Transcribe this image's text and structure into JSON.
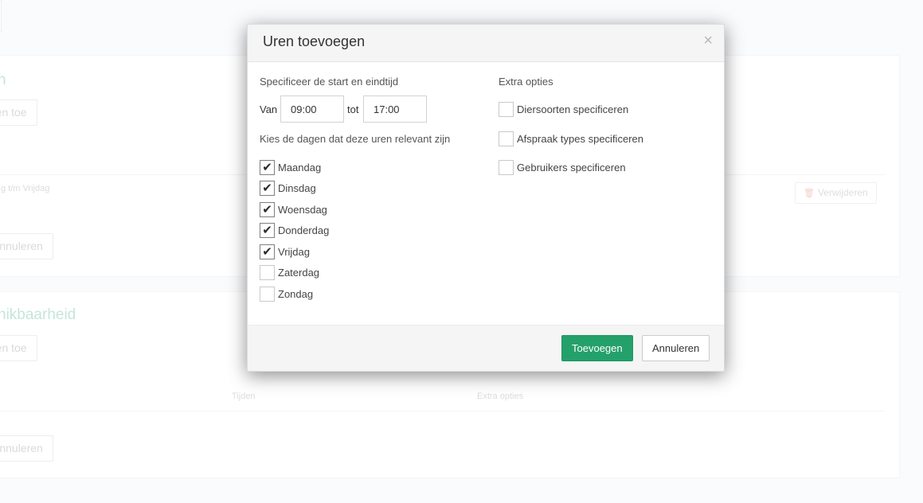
{
  "background": {
    "card1": {
      "title_fragment": "n",
      "add_button_fragment": "ren toe",
      "row_text_fragment": "g t/m Vrijdag",
      "delete_button": "Verwijderen",
      "cancel_button": "Annuleren"
    },
    "card2": {
      "title_fragment": "nikbaarheid",
      "add_button_fragment": "ren toe",
      "col_times": "Tijden",
      "col_extra": "Extra opties",
      "cancel_button": "Annuleren"
    }
  },
  "modal": {
    "title": "Uren toevoegen",
    "close_symbol": "×",
    "time_section_label": "Specificeer de start en eindtijd",
    "from_label": "Van",
    "from_value": "09:00",
    "to_label": "tot",
    "to_value": "17:00",
    "days_label": "Kies de dagen dat deze uren relevant zijn",
    "days": [
      {
        "label": "Maandag",
        "checked": true
      },
      {
        "label": "Dinsdag",
        "checked": true
      },
      {
        "label": "Woensdag",
        "checked": true
      },
      {
        "label": "Donderdag",
        "checked": true
      },
      {
        "label": "Vrijdag",
        "checked": true
      },
      {
        "label": "Zaterdag",
        "checked": false
      },
      {
        "label": "Zondag",
        "checked": false
      }
    ],
    "extra_label": "Extra opties",
    "extra_options": [
      {
        "label": "Diersoorten specificeren",
        "checked": false
      },
      {
        "label": "Afspraak types specificeren",
        "checked": false
      },
      {
        "label": "Gebruikers specificeren",
        "checked": false
      }
    ],
    "primary_button": "Toevoegen",
    "cancel_button": "Annuleren",
    "check_symbol": "✔",
    "colors": {
      "primary": "#24a06b",
      "background_title": "#a7d8c9"
    }
  }
}
